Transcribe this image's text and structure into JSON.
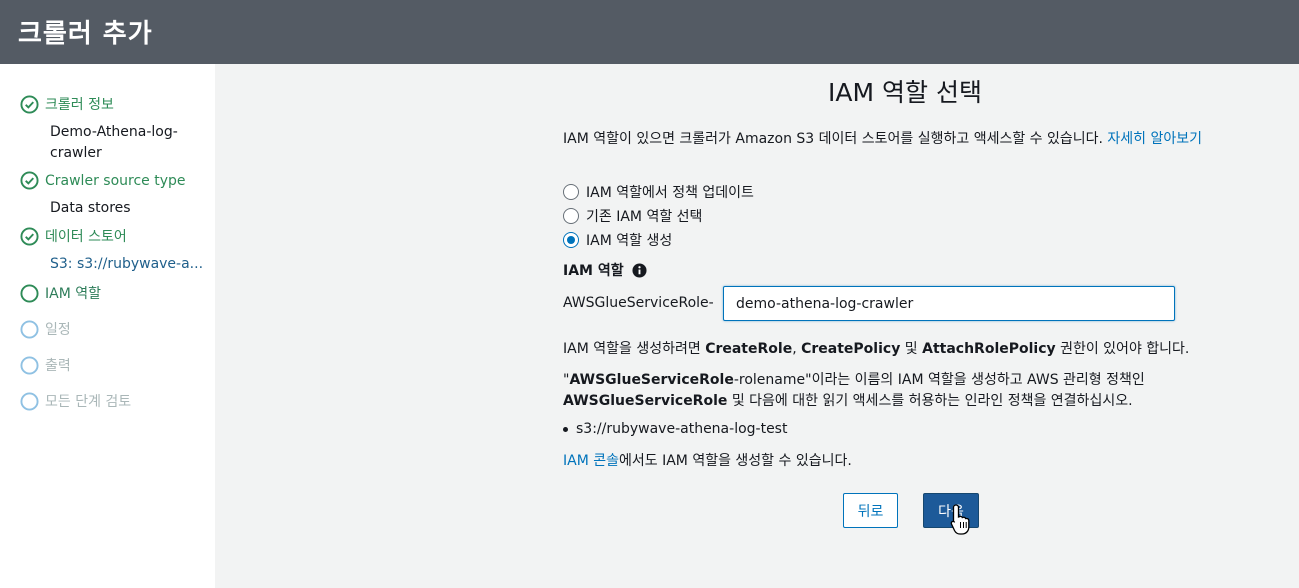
{
  "header": {
    "title": "크롤러 추가"
  },
  "sidebar": {
    "steps": [
      {
        "label": "크롤러 정보",
        "status": "done",
        "sub": "Demo-Athena-log-crawler"
      },
      {
        "label": "Crawler source type",
        "status": "done",
        "sub": "Data stores"
      },
      {
        "label": "데이터 스토어",
        "status": "done",
        "sub": "S3: s3://rubywave-a..."
      },
      {
        "label": "IAM 역할",
        "status": "current"
      },
      {
        "label": "일정",
        "status": "pending"
      },
      {
        "label": "출력",
        "status": "pending"
      },
      {
        "label": "모든 단계 검토",
        "status": "pending"
      }
    ]
  },
  "main": {
    "title": "IAM 역할 선택",
    "description": "IAM 역할이 있으면 크롤러가 Amazon S3 데이터 스토어를 실행하고 액세스할 수 있습니다.",
    "learn_more": "자세히 알아보기",
    "options": [
      {
        "label": "IAM 역할에서 정책 업데이트",
        "checked": false
      },
      {
        "label": "기존 IAM 역할 선택",
        "checked": false
      },
      {
        "label": "IAM 역할 생성",
        "checked": true
      }
    ],
    "role_label": "IAM 역할",
    "role_prefix": "AWSGlueServiceRole-",
    "role_value": "demo-athena-log-crawler",
    "perm_text_1": "IAM 역할을 생성하려면 ",
    "perm_create_role": "CreateRole",
    "perm_comma": ", ",
    "perm_create_policy": "CreatePolicy",
    "perm_and": " 및 ",
    "perm_attach": "AttachRolePolicy",
    "perm_text_2": " 권한이 있어야 합니다.",
    "role_desc_q1": "\"",
    "role_desc_bold1": "AWSGlueServiceRole",
    "role_desc_rolename": "-rolename",
    "role_desc_mid": "\"이라는 이름의 IAM 역할을 생성하고 AWS 관리형 정책인 ",
    "role_desc_bold2": "AWSGlueServiceRole",
    "role_desc_end": " 및 다음에 대한 읽기 액세스를 허용하는 인라인 정책을 연결하십시오.",
    "bucket": "s3://rubywave-athena-log-test",
    "console_link": "IAM 콘솔",
    "console_text": "에서도 IAM 역할을 생성할 수 있습니다.",
    "back_label": "뒤로",
    "next_label": "다음"
  },
  "colors": {
    "header_bg": "#545b64",
    "done_green": "#2e8b57",
    "link_blue": "#0073bb",
    "primary_button": "#1d5a99",
    "pending_gray": "#aab7b8"
  }
}
